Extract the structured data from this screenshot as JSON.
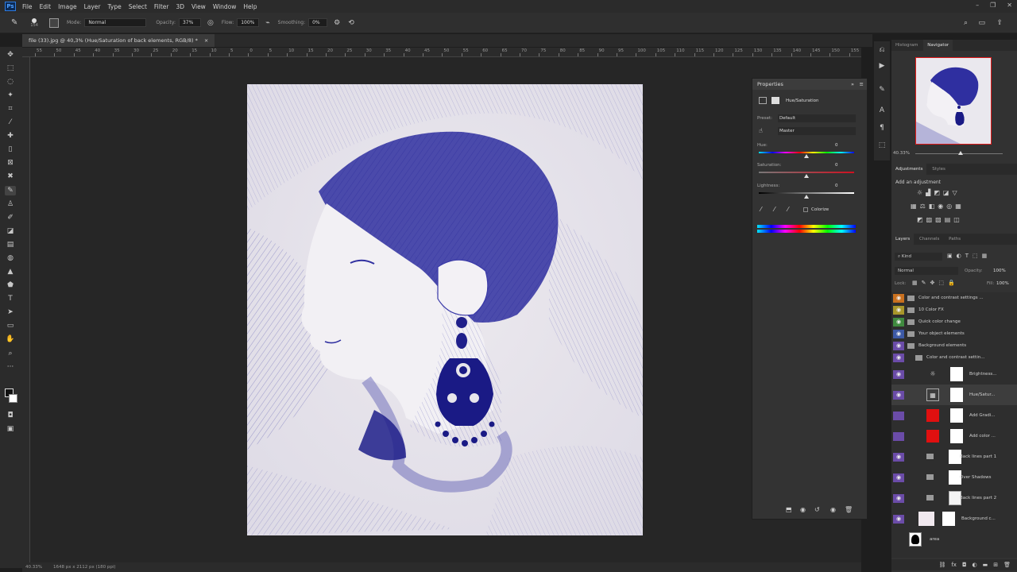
{
  "menu": [
    "File",
    "Edit",
    "Image",
    "Layer",
    "Type",
    "Select",
    "Filter",
    "3D",
    "View",
    "Window",
    "Help"
  ],
  "options": {
    "mode_label": "Mode:",
    "mode_value": "Normal",
    "opacity_label": "Opacity:",
    "opacity_value": "37%",
    "flow_label": "Flow:",
    "flow_value": "100%",
    "smoothing_label": "Smoothing:",
    "smoothing_value": "0%",
    "brush_size": "154"
  },
  "document": {
    "tab_title": "file (33).jpg @ 40,3% (Hue/Saturation of back elements, RGB/8) *"
  },
  "ruler_numbers": [
    "55",
    "50",
    "45",
    "40",
    "35",
    "30",
    "25",
    "20",
    "15",
    "10",
    "5",
    "0",
    "5",
    "10",
    "15",
    "20",
    "25",
    "30",
    "35",
    "40",
    "45",
    "50",
    "55",
    "60",
    "65",
    "70",
    "75",
    "80",
    "85",
    "90",
    "95",
    "100",
    "105",
    "110",
    "115",
    "120",
    "125",
    "130",
    "135",
    "140",
    "145",
    "150",
    "155"
  ],
  "status": {
    "zoom": "40.33%",
    "size": "1648 px x 2112 px (180 ppi)"
  },
  "properties": {
    "title": "Properties",
    "adj_name": "Hue/Saturation",
    "preset_label": "Preset:",
    "preset_value": "Default",
    "channel_value": "Master",
    "hue_label": "Hue:",
    "hue_value": "0",
    "sat_label": "Saturation:",
    "sat_value": "0",
    "light_label": "Lightness:",
    "light_value": "0",
    "colorize_label": "Colorize"
  },
  "panels": {
    "tab_histogram": "Histogram",
    "tab_navigator": "Navigator",
    "nav_zoom": "40.33%",
    "tab_adjustments": "Adjustments",
    "tab_styles": "Styles",
    "add_adjustment": "Add an adjustment",
    "tab_layers": "Layers",
    "tab_channels": "Channels",
    "tab_paths": "Paths",
    "kind_label": "Kind",
    "blend_value": "Normal",
    "opacity_label": "Opacity:",
    "opacity_value": "100%",
    "lock_label": "Lock:",
    "fill_label": "Fill:",
    "fill_value": "100%"
  },
  "layers": [
    {
      "name": "Color and contrast settings ...",
      "eye": "#c9701f",
      "type": "folder",
      "indent": 0
    },
    {
      "name": "10 Color FX",
      "eye": "#a8962a",
      "type": "folder",
      "indent": 0
    },
    {
      "name": "Quick color change",
      "eye": "#3f8a3f",
      "type": "folder",
      "indent": 0
    },
    {
      "name": "Your object elements",
      "eye": "#3d5aa6",
      "type": "folder",
      "indent": 0
    },
    {
      "name": "Background elements",
      "eye": "#6b4ca8",
      "type": "folder",
      "indent": 0
    },
    {
      "name": "Color and contrast settin...",
      "eye": "#6b4ca8",
      "type": "folder",
      "indent": 1
    },
    {
      "name": "Brightness...",
      "eye": "#6b4ca8",
      "type": "adjust",
      "indent": 2
    },
    {
      "name": "Hue/Satur...",
      "eye": "#6b4ca8",
      "type": "adjust",
      "indent": 2
    },
    {
      "name": "Add Gradi...",
      "eye": "#6b4ca8",
      "type": "gradient",
      "indent": 2
    },
    {
      "name": "Add color ...",
      "eye": "#6b4ca8",
      "type": "color",
      "indent": 2
    },
    {
      "name": "Back lines part 1",
      "eye": "#6b4ca8",
      "type": "group",
      "indent": 1
    },
    {
      "name": "Over Shadows",
      "eye": "#6b4ca8",
      "type": "group",
      "indent": 1
    },
    {
      "name": "Back lines part 2",
      "eye": "#6b4ca8",
      "type": "group",
      "indent": 1
    },
    {
      "name": "Background c...",
      "eye": "#6b4ca8",
      "type": "fill",
      "indent": 1
    },
    {
      "name": "area",
      "eye": "",
      "type": "silhouette",
      "indent": 0
    }
  ],
  "colors": {
    "accent": "#2f2fa0",
    "red_swatch": "#e01010"
  }
}
